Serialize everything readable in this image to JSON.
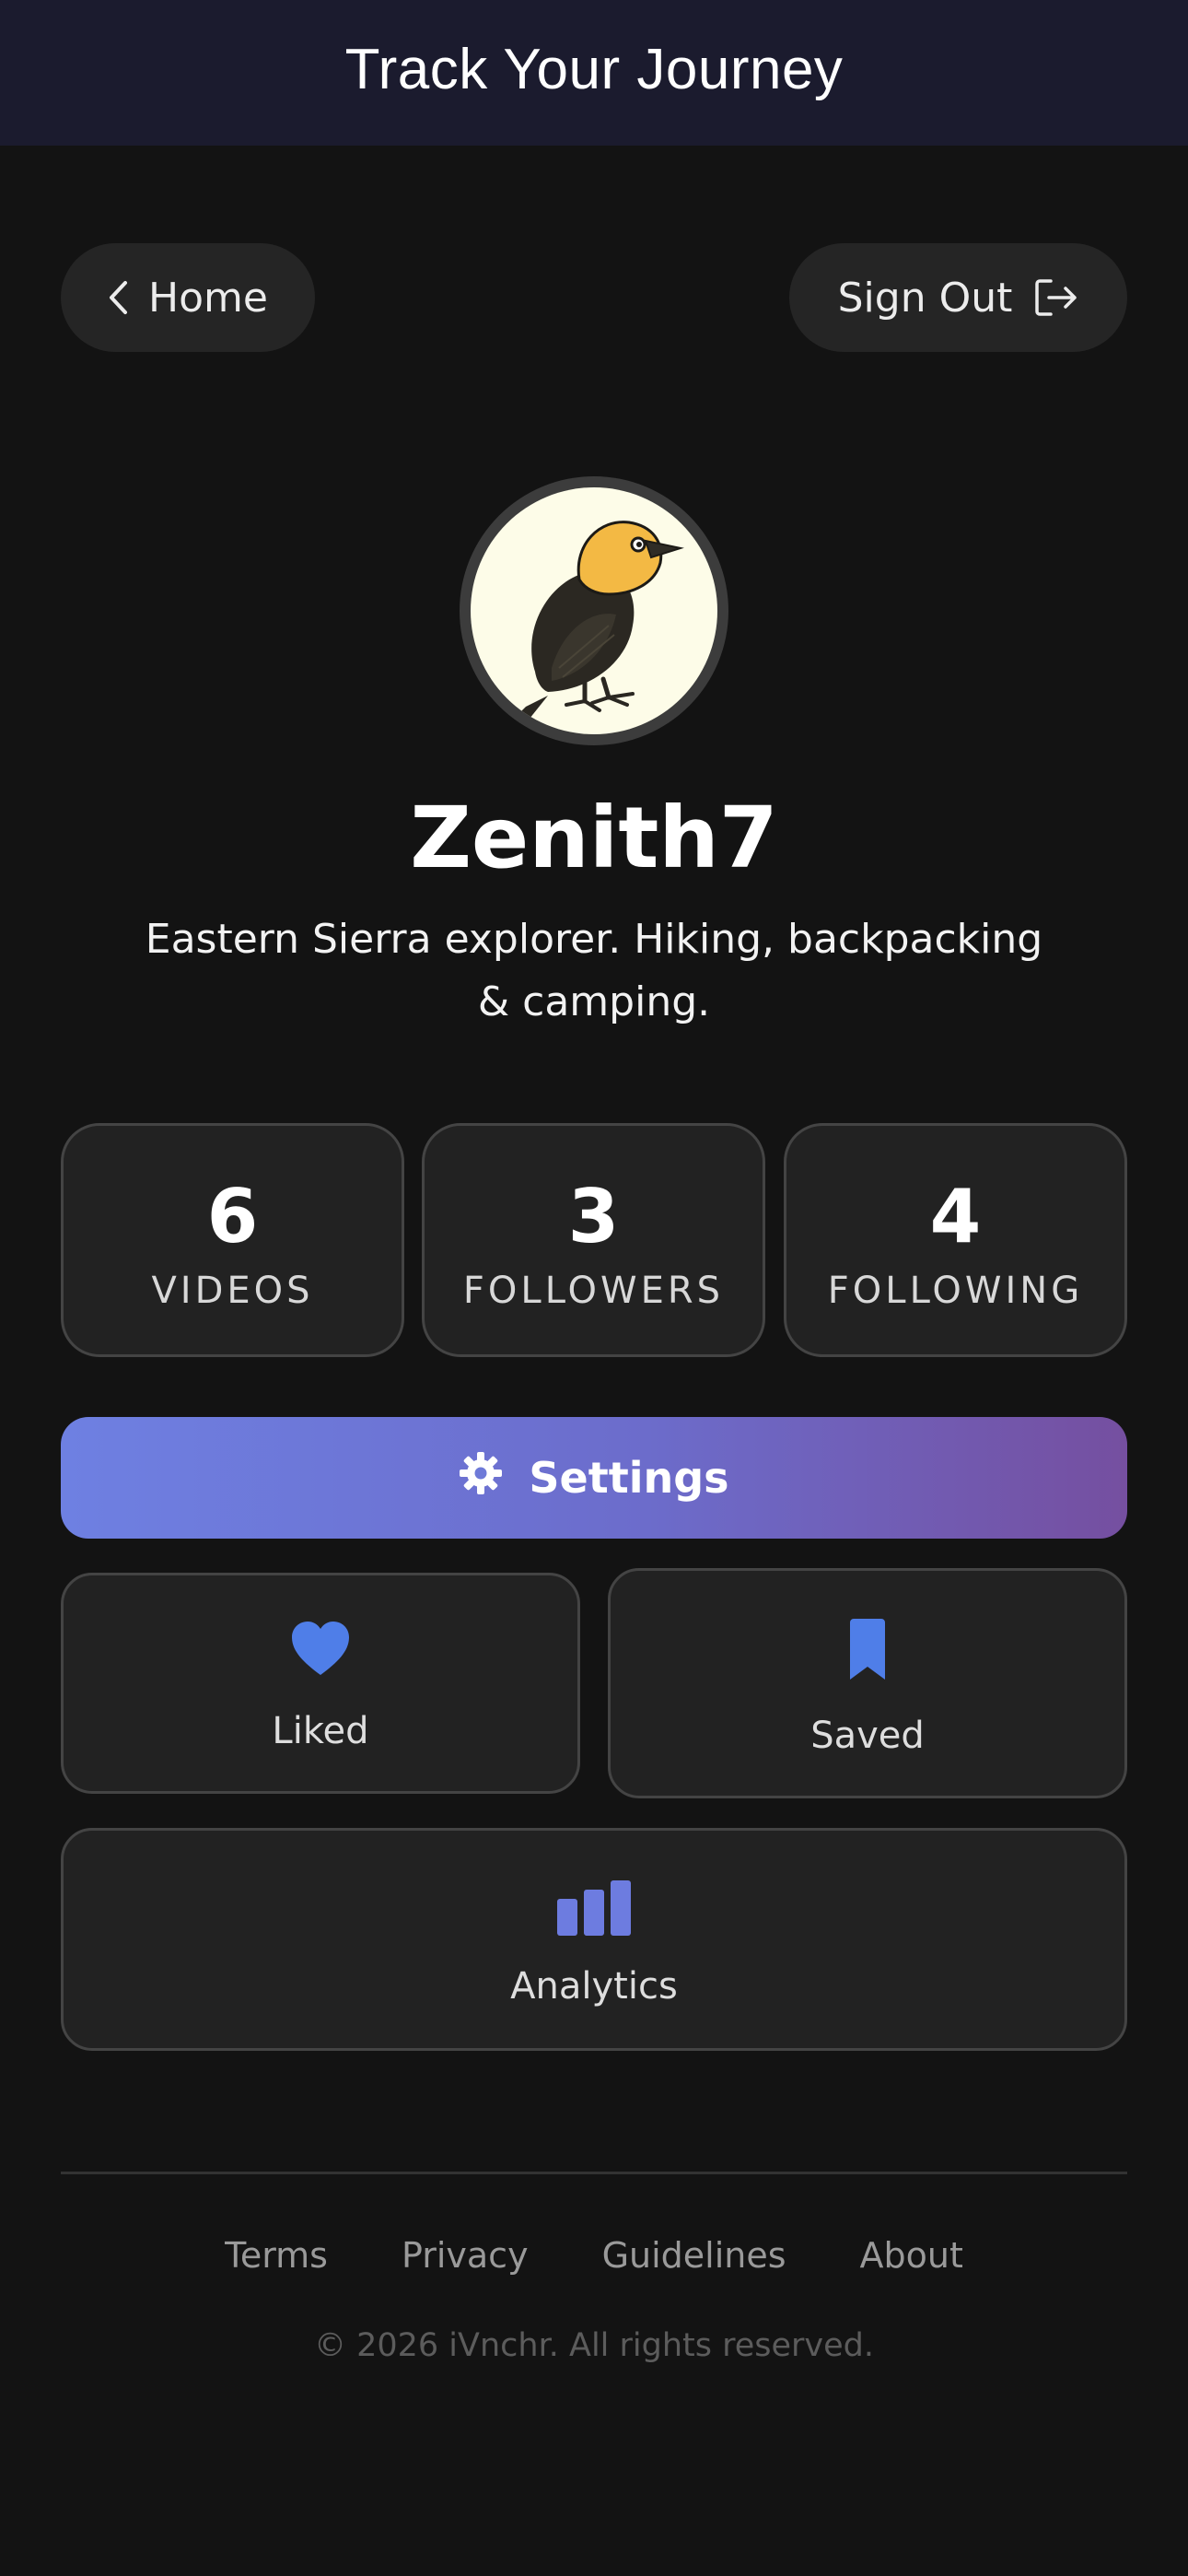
{
  "header": {
    "title": "Track Your Journey"
  },
  "nav": {
    "home_label": "Home",
    "signout_label": "Sign Out",
    "home_icon": "chevron-left-icon",
    "signout_icon": "exit-icon"
  },
  "profile": {
    "avatar_icon": "bird-avatar",
    "username": "Zenith7",
    "bio": "Eastern Sierra explorer.  Hiking, backpacking & camping."
  },
  "stats": [
    {
      "value": "6",
      "label": "VIDEOS"
    },
    {
      "value": "3",
      "label": "FOLLOWERS"
    },
    {
      "value": "4",
      "label": "FOLLOWING"
    }
  ],
  "actions": {
    "settings_label": "Settings",
    "settings_icon": "gear-icon",
    "liked_label": "Liked",
    "liked_icon": "heart-icon",
    "saved_label": "Saved",
    "saved_icon": "bookmark-icon",
    "analytics_label": "Analytics",
    "analytics_icon": "bar-chart-icon"
  },
  "footer": {
    "links": [
      "Terms",
      "Privacy",
      "Guidelines",
      "About"
    ],
    "copyright": "© 2026 iVnchr. All rights reserved."
  },
  "colors": {
    "background": "#131313",
    "header_bg": "#1b1b2e",
    "card_bg": "#222222",
    "accent_blue": "#4f7ee8",
    "accent_indigo": "#6d7ce0",
    "gradient_start": "#6e80e2",
    "gradient_end": "#754fa0"
  }
}
